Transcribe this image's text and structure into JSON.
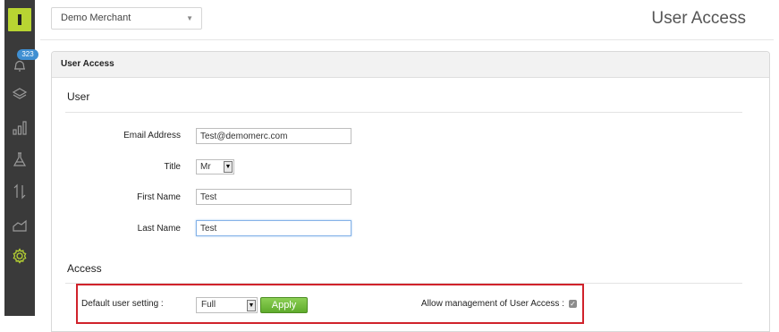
{
  "sidebar": {
    "notification_count": "323",
    "items": [
      {
        "name": "notifications",
        "icon": "bell-icon"
      },
      {
        "name": "layers",
        "icon": "layers-icon"
      },
      {
        "name": "reports",
        "icon": "bar-chart-icon"
      },
      {
        "name": "lab",
        "icon": "flask-icon"
      },
      {
        "name": "transactions",
        "icon": "arrows-updown-icon"
      },
      {
        "name": "analytics",
        "icon": "area-chart-icon"
      },
      {
        "name": "settings",
        "icon": "gear-icon",
        "active": true
      }
    ],
    "accent_color": "#b8d432"
  },
  "header": {
    "merchant": "Demo Merchant",
    "title": "User Access"
  },
  "panel": {
    "heading": "User Access",
    "user_section": "User",
    "fields": {
      "email_label": "Email Address",
      "email_value": "Test@demomerc.com",
      "title_label": "Title",
      "title_value": "Mr",
      "first_name_label": "First Name",
      "first_name_value": "Test",
      "last_name_label": "Last Name",
      "last_name_value": "Test"
    },
    "access_section": "Access",
    "access": {
      "default_label": "Default user setting :",
      "default_value": "Full",
      "apply_label": "Apply",
      "allow_label": "Allow management of User Access :",
      "allow_checked": true
    }
  }
}
